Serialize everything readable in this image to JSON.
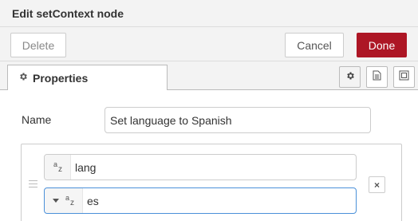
{
  "dialog": {
    "title": "Edit setContext node"
  },
  "toolbar": {
    "delete_label": "Delete",
    "cancel_label": "Cancel",
    "done_label": "Done"
  },
  "tabs": [
    {
      "label": "Properties",
      "icon": "gear-icon"
    }
  ],
  "tab_icons": [
    "gear-icon",
    "document-icon",
    "frame-icon"
  ],
  "form": {
    "name_label": "Name",
    "name_value": "Set language to Spanish"
  },
  "rules": [
    {
      "key_type_icon": "string-type-icon",
      "key_value": "lang",
      "value_type_icon": "string-type-icon",
      "value_value": "es",
      "remove_label": "×"
    }
  ],
  "type_icon_text": {
    "a": "a",
    "z": "z"
  },
  "colors": {
    "done_button": "#ad1625",
    "focus_border": "#4a90d9",
    "header_bg": "#f3f3f3"
  }
}
